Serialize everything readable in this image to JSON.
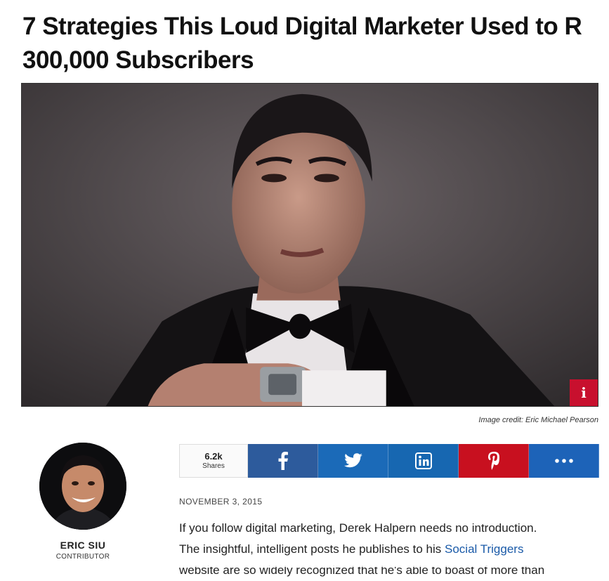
{
  "article": {
    "title": "7 Strategies This Loud Digital Marketer Used to R",
    "title_line2": "300,000 Subscribers",
    "image_credit": "Image credit: Eric Michael Pearson",
    "date": "NOVEMBER 3, 2015",
    "body_line1": "If you follow digital marketing, Derek Halpern needs no introduction.",
    "body_line2_pre": "The insightful, intelligent posts he publishes to his ",
    "body_line2_link": "Social Triggers",
    "body_line3": "website are so widely recognized that he's able to boast of more than"
  },
  "hero": {
    "info_label": "i",
    "info_color": "#c8102e"
  },
  "author": {
    "name": "ERIC SIU",
    "role": "CONTRIBUTOR"
  },
  "share": {
    "count": "6.2k",
    "count_label": "Shares",
    "buttons": [
      {
        "name": "facebook",
        "icon": "facebook-icon",
        "color": "#2d5b9c"
      },
      {
        "name": "twitter",
        "icon": "twitter-icon",
        "color": "#1b6ab8"
      },
      {
        "name": "linkedin",
        "icon": "linkedin-icon",
        "color": "#1767b1"
      },
      {
        "name": "pinterest",
        "icon": "pinterest-icon",
        "color": "#c8101f"
      },
      {
        "name": "more",
        "icon": "more-icon",
        "color": "#1d63b8"
      }
    ]
  }
}
